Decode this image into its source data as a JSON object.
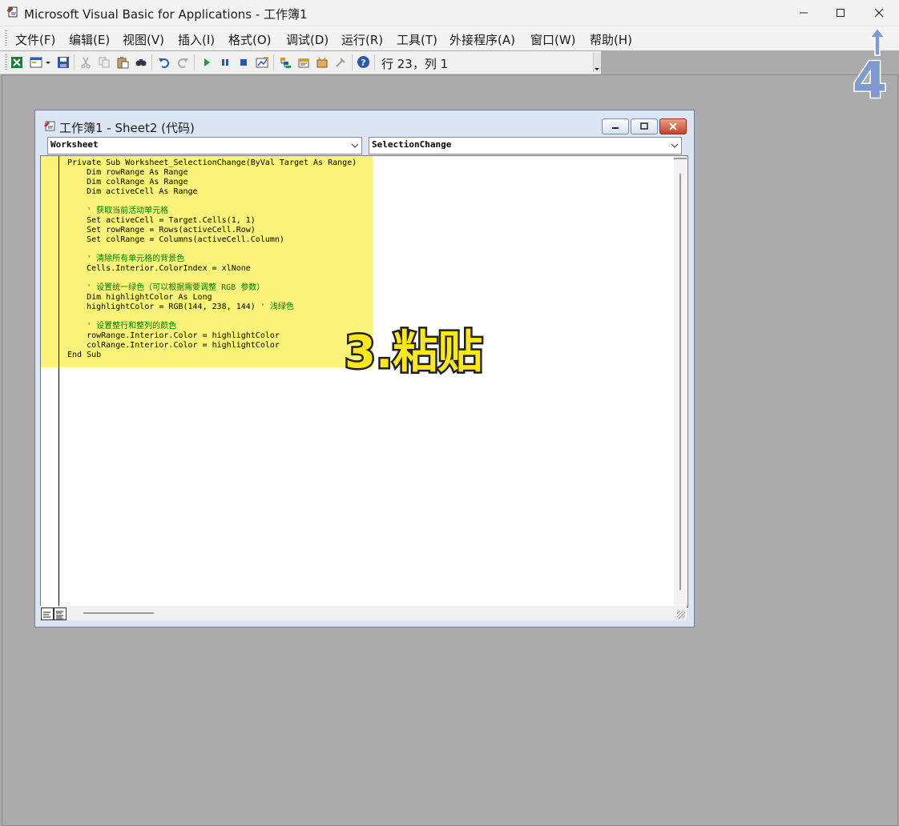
{
  "app": {
    "title": "Microsoft Visual Basic for Applications - 工作簿1"
  },
  "window_controls": {
    "minimize_glyph": "–",
    "maximize_glyph": "□",
    "close_glyph": "✕"
  },
  "menu": {
    "items": [
      "文件(F)",
      "编辑(E)",
      "视图(V)",
      "插入(I)",
      "格式(O)",
      "调试(D)",
      "运行(R)",
      "工具(T)",
      "外接程序(A)",
      "窗口(W)",
      "帮助(H)"
    ]
  },
  "toolbar": {
    "cursor_position": "行 23，列 1"
  },
  "code_window": {
    "title": "工作簿1 - Sheet2 (代码)",
    "object_combo": "Worksheet",
    "procedure_combo": "SelectionChange",
    "code_lines": [
      "Private Sub Worksheet_SelectionChange(ByVal Target As Range)",
      "    Dim rowRange As Range",
      "    Dim colRange As Range",
      "    Dim activeCell As Range",
      "",
      "    ' 获取当前活动单元格",
      "    Set activeCell = Target.Cells(1, 1)",
      "    Set rowRange = Rows(activeCell.Row)",
      "    Set colRange = Columns(activeCell.Column)",
      "",
      "    ' 清除所有单元格的背景色",
      "    Cells.Interior.ColorIndex = xlNone",
      "",
      "    ' 设置统一绿色（可以根据需要调整 RGB 参数）",
      "    Dim highlightColor As Long",
      "    highlightColor = RGB(144, 238, 144) ' 浅绿色",
      "",
      "    ' 设置整行和整列的颜色",
      "    rowRange.Interior.Color = highlightColor",
      "    colRange.Interior.Color = highlightColor",
      "End Sub"
    ]
  },
  "annotations": {
    "step3": "3.粘贴",
    "step4": "4"
  },
  "colors": {
    "highlight": "#fbf37a",
    "step3_fill": "#fbe81b",
    "step4_fill": "#7f9ad0",
    "comment": "#008000"
  }
}
